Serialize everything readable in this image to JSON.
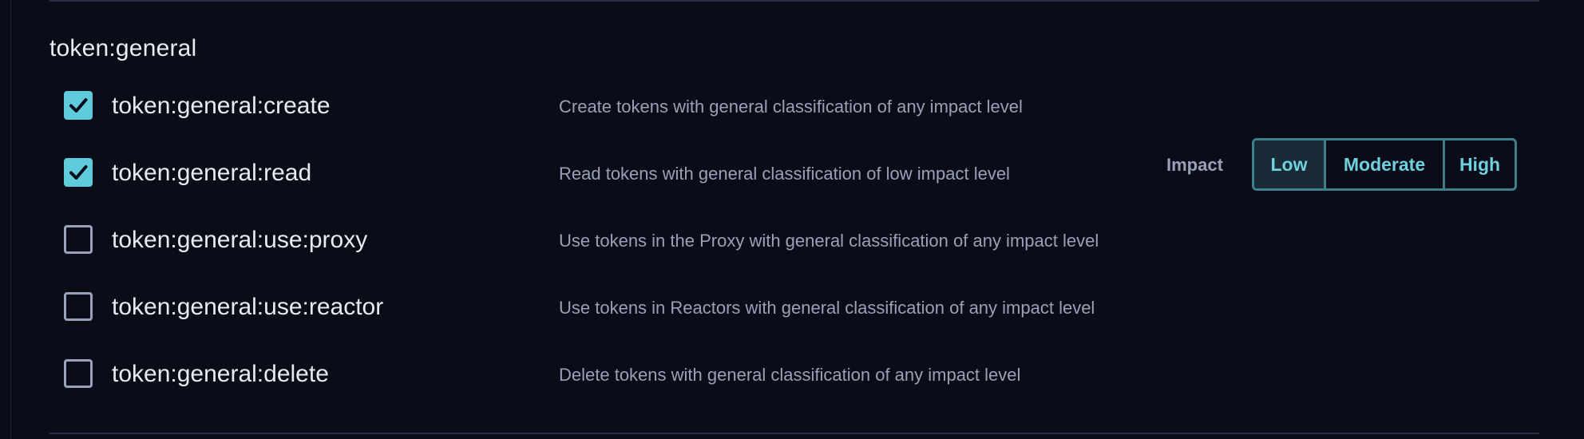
{
  "group": {
    "title": "token:general"
  },
  "permissions": [
    {
      "name": "token:general:create",
      "description": "Create tokens with general classification of any impact level",
      "checked": true
    },
    {
      "name": "token:general:read",
      "description": "Read tokens with general classification of low impact level",
      "checked": true
    },
    {
      "name": "token:general:use:proxy",
      "description": "Use tokens in the Proxy with general classification of any impact level",
      "checked": false
    },
    {
      "name": "token:general:use:reactor",
      "description": "Use tokens in Reactors with general classification of any impact level",
      "checked": false
    },
    {
      "name": "token:general:delete",
      "description": "Delete tokens with general classification of any impact level",
      "checked": false
    }
  ],
  "impact": {
    "label": "Impact",
    "options": [
      "Low",
      "Moderate",
      "High"
    ],
    "selected": "Low"
  },
  "colors": {
    "accent": "#5fcbdd",
    "background": "#0a0c18",
    "muted_text": "#9aa0b6"
  },
  "icons": {
    "checkbox_checked": "checkmark-icon"
  }
}
